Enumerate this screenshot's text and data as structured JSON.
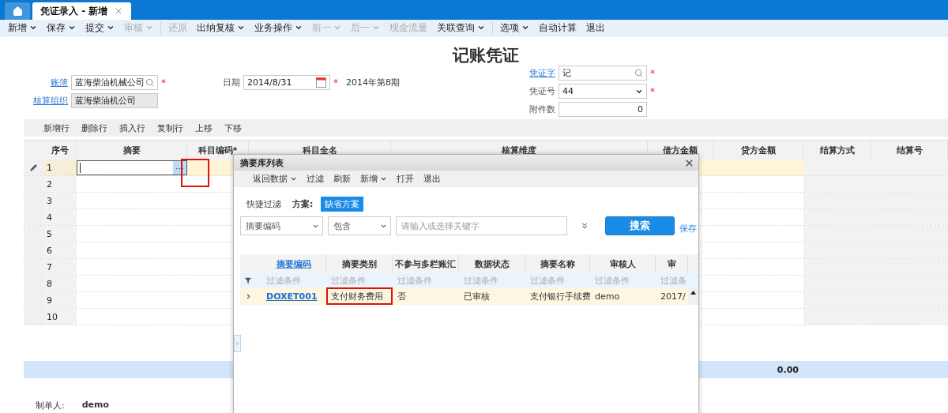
{
  "tabs": [
    {
      "kind": "home",
      "selected": false
    },
    {
      "kind": "page",
      "label": "凭证录入 - 新增",
      "selected": true,
      "closable": true
    }
  ],
  "toolbar": [
    {
      "label": "新增",
      "menu": true,
      "disabled": false,
      "separator_after": false
    },
    {
      "label": "保存",
      "menu": true,
      "disabled": false,
      "separator_after": false
    },
    {
      "label": "提交",
      "menu": true,
      "disabled": false,
      "separator_after": false
    },
    {
      "label": "审核",
      "menu": true,
      "disabled": true,
      "separator_after": true
    },
    {
      "label": "还原",
      "menu": false,
      "disabled": true,
      "separator_after": false
    },
    {
      "label": "出纳复核",
      "menu": true,
      "disabled": false,
      "separator_after": false
    },
    {
      "label": "业务操作",
      "menu": true,
      "disabled": false,
      "separator_after": false
    },
    {
      "label": "前一",
      "menu": true,
      "disabled": true,
      "separator_after": false
    },
    {
      "label": "后一",
      "menu": true,
      "disabled": true,
      "separator_after": false
    },
    {
      "label": "现金流量",
      "menu": false,
      "disabled": true,
      "separator_after": false
    },
    {
      "label": "关联查询",
      "menu": true,
      "disabled": false,
      "separator_after": true
    },
    {
      "label": "选项",
      "menu": true,
      "disabled": false,
      "separator_after": false
    },
    {
      "label": "自动计算",
      "menu": false,
      "disabled": false,
      "separator_after": false
    },
    {
      "label": "退出",
      "menu": false,
      "disabled": false,
      "separator_after": false
    }
  ],
  "title": "记账凭证",
  "required_mark": "*",
  "form": {
    "book": {
      "label": "账簿",
      "value": "蓝海柴油机械公司",
      "required": true
    },
    "org": {
      "label": "核算组织",
      "value": "蓝海柴油机公司",
      "disabled": true
    },
    "date": {
      "label": "日期",
      "value": "2014/8/31",
      "required": true,
      "period": "2014年第8期"
    },
    "voucher_word": {
      "label": "凭证字",
      "value": "记",
      "required": true
    },
    "voucher_no": {
      "label": "凭证号",
      "value": "44",
      "required": true
    },
    "attachments": {
      "label": "附件数",
      "value": "0"
    }
  },
  "row_actions": [
    "新增行",
    "删除行",
    "插入行",
    "复制行",
    "上移",
    "下移"
  ],
  "grid": {
    "columns": [
      {
        "label": "序号",
        "required": false
      },
      {
        "label": "摘要",
        "required": false
      },
      {
        "label": "科目编码",
        "required": true
      },
      {
        "label": "科目全名",
        "required": false
      },
      {
        "label": "核算维度",
        "required": false
      },
      {
        "label": "借方金额",
        "required": false
      },
      {
        "label": "贷方金额",
        "required": false
      },
      {
        "label": "结算方式",
        "required": false
      },
      {
        "label": "结算号",
        "required": false
      }
    ],
    "rows": [
      {
        "no": "1",
        "selected": true
      },
      {
        "no": "2",
        "selected": false
      },
      {
        "no": "3",
        "selected": false
      },
      {
        "no": "4",
        "selected": false
      },
      {
        "no": "5",
        "selected": false
      },
      {
        "no": "6",
        "selected": false
      },
      {
        "no": "7",
        "selected": false
      },
      {
        "no": "8",
        "selected": false
      },
      {
        "no": "9",
        "selected": false
      },
      {
        "no": "10",
        "selected": false
      }
    ],
    "editor": {
      "highlighted": true,
      "button": "···"
    },
    "credit_total": "0.00"
  },
  "creator": {
    "label": "制单人:",
    "value": "demo"
  },
  "dialog": {
    "title": "摘要库列表",
    "toolbar": [
      {
        "label": "返回数据",
        "menu": true
      },
      {
        "label": "过滤",
        "menu": false
      },
      {
        "label": "刷新",
        "menu": false
      },
      {
        "label": "新增",
        "menu": true
      },
      {
        "label": "打开",
        "menu": false
      },
      {
        "label": "退出",
        "menu": false
      }
    ],
    "quick_filter": "快捷过滤",
    "scheme_label": "方案:",
    "scheme": "缺省方案",
    "filter_field": "摘要编码",
    "filter_op": "包含",
    "search_placeholder": "请输入或选择关键字",
    "search_button": "搜索",
    "save_link": "保存",
    "columns": [
      {
        "label": "摘要编码",
        "link": true
      },
      {
        "label": "摘要类别",
        "link": false
      },
      {
        "label": "不参与多栏账汇",
        "link": false
      },
      {
        "label": "数据状态",
        "link": false
      },
      {
        "label": "摘要名称",
        "link": false
      },
      {
        "label": "审核人",
        "link": false
      },
      {
        "label": "审",
        "link": false
      }
    ],
    "filters": [
      "过滤条件",
      "过滤条件",
      "过滤条件",
      "过滤条件",
      "过滤条件",
      "过滤条件",
      "过滤条"
    ],
    "rows": [
      {
        "selected": true,
        "cells": [
          {
            "text": "DOXET001",
            "highlighted": false
          },
          {
            "text": "支付财务费用",
            "highlighted": true
          },
          {
            "text": "否",
            "highlighted": false
          },
          {
            "text": "已审核",
            "highlighted": false
          },
          {
            "text": "支付银行手续费",
            "highlighted": false
          },
          {
            "text": "demo",
            "highlighted": false
          },
          {
            "text": "2017/",
            "highlighted": false
          }
        ]
      }
    ]
  }
}
